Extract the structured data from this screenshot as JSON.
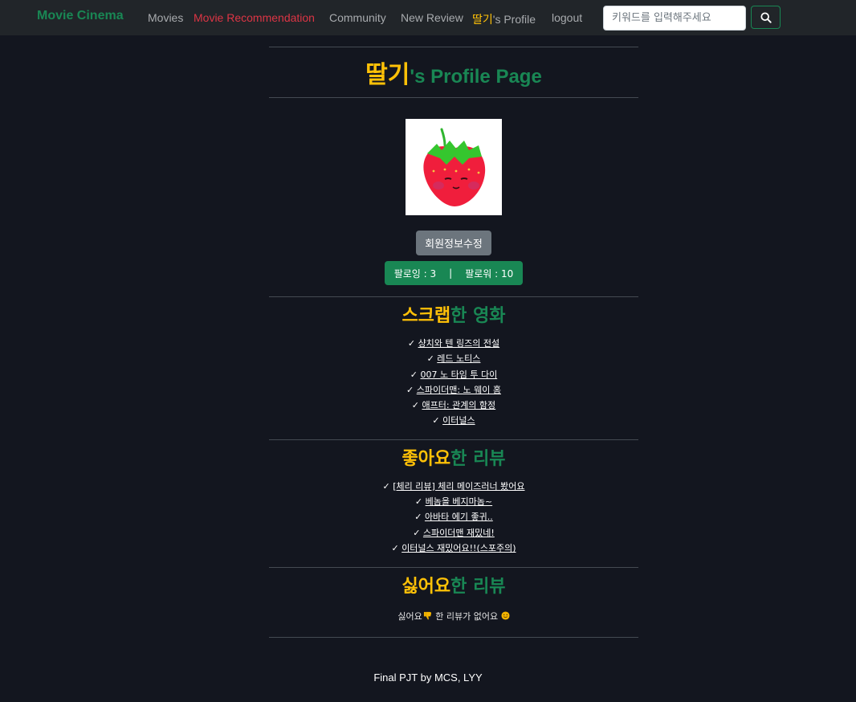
{
  "navbar": {
    "brand": "Movie Cinema",
    "movies": "Movies",
    "recommendation": "Movie Recommendation",
    "community": "Community",
    "new_review": "New Review",
    "profile_name": "딸기",
    "profile_suffix": "'s Profile",
    "logout": "logout",
    "search_placeholder": "키워드를 입력해주세요"
  },
  "profile": {
    "name": "딸기",
    "title_suffix": "'s Profile Page",
    "edit_button": "회원정보수정",
    "following_label": "팔로잉 : 3",
    "separator": "|",
    "followers_label": "팔로워 : 10"
  },
  "scrapped": {
    "title_highlight": "스크랩",
    "title_rest": "한 영화",
    "items": [
      "샹치와 텐 링즈의 전설",
      "레드 노티스",
      "007 노 타임 투 다이",
      "스파이더맨: 노 웨이 홈",
      "애프터: 관계의 함정",
      "이터널스"
    ]
  },
  "liked": {
    "title_highlight": "좋아요",
    "title_rest": "한 리뷰",
    "items": [
      "[체리 리뷰] 체리 메이즈러너 봤어요",
      "베놈을 베지마놈~",
      "아바타 에기 좋귀..",
      "스파이더맨 재밌네!",
      "이터널스 재밌어요!!(스포주의)"
    ]
  },
  "disliked": {
    "title_highlight": "싫어요",
    "title_rest": "한 리뷰",
    "empty_before": "싫어요",
    "empty_middle": "한 리뷰가 없어요"
  },
  "check_mark": "✓",
  "footer": "Final PJT by MCS, LYY",
  "colors": {
    "accent_green": "#198754",
    "accent_yellow": "#ffc107",
    "danger_red": "#dc3545",
    "background": "#13161f",
    "navbar": "#212529"
  },
  "icons": [
    "search-icon",
    "strawberry-avatar",
    "thumbs-down-icon",
    "smile-icon"
  ]
}
